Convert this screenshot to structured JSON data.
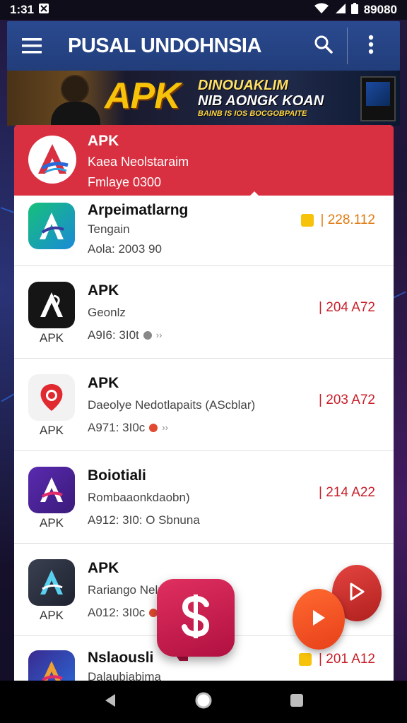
{
  "status_bar": {
    "time": "1:31",
    "right_text": "89080"
  },
  "app_bar": {
    "title": "PUSAL UNDOHNSIA",
    "menu_icon": "hamburger-menu-icon",
    "search_icon": "search-icon",
    "more_icon": "more-vert-icon"
  },
  "banner": {
    "headline": "APK",
    "line1": "DINOUAKLIM",
    "line2": "NIB AONGK KOAN",
    "line3": "BAINB IS IOS BOCGOBPAITE"
  },
  "featured": {
    "title": "APK",
    "subtitle": "Kaea Neolstaraim",
    "meta": "Fmlaye 0300",
    "accent": "#d83040"
  },
  "items": [
    {
      "title": "Arpeimatlarng",
      "subtitle": "Tengain",
      "meta": "Aola: 2003 90",
      "value": "| 228.112",
      "value_color": "#e07a10",
      "icon_label": "",
      "icon_bg": "#1fb86a"
    },
    {
      "title": "APK",
      "subtitle": "Geonlz",
      "meta": "A9I6: 3I0t",
      "value": "| 204 A72",
      "value_color": "#c8202a",
      "icon_label": "APK",
      "icon_bg": "#111111"
    },
    {
      "title": "APK",
      "subtitle": "Daeolye Nedotlapaits (AScblar)",
      "meta": "A971: 3I0c",
      "value": "| 203 A72",
      "value_color": "#c8202a",
      "icon_label": "APK",
      "icon_bg": "#f2f2f2"
    },
    {
      "title": "Boiotiali",
      "subtitle": "Rombaaonkdaobn)",
      "meta": "A912: 3I0: O Sbnuna",
      "value": "| 214 A22",
      "value_color": "#c8202a",
      "icon_label": "APK",
      "icon_bg": "#4a1e8a"
    },
    {
      "title": "APK",
      "subtitle": "Rariango Nelr1",
      "meta": "A012: 3I0c",
      "value": "",
      "value_color": "#c8202a",
      "icon_label": "APK",
      "icon_bg": "#2a3040"
    },
    {
      "title": "Nslaousli",
      "subtitle": "Dalaubiabima",
      "meta": "",
      "value": "| 201 A12",
      "value_color": "#c8202a",
      "icon_label": "",
      "icon_bg": "#3a2a90"
    }
  ],
  "fabs": {
    "dollar_icon": "dollar-icon",
    "play_icon": "play-icon"
  },
  "nav_bar": {
    "back_icon": "back-triangle-icon",
    "home_icon": "home-circle-icon",
    "recents_icon": "recents-square-icon"
  }
}
